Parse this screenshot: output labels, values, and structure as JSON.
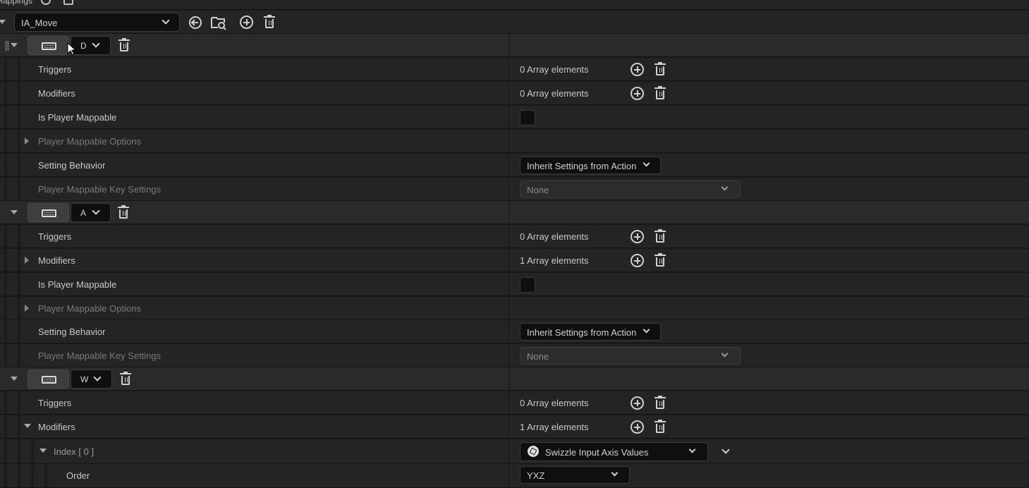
{
  "top": {
    "label": "Mappings"
  },
  "action": {
    "selected": "IA_Move"
  },
  "mappings": [
    {
      "key": "D",
      "rows": [
        {
          "label": "Triggers",
          "value": "0 Array elements"
        },
        {
          "label": "Modifiers",
          "value": "0 Array elements"
        },
        {
          "label": "Is Player Mappable"
        },
        {
          "label": "Player Mappable Options"
        },
        {
          "label": "Setting Behavior",
          "value": "Inherit Settings from Action"
        },
        {
          "label": "Player Mappable Key Settings",
          "value": "None"
        }
      ]
    },
    {
      "key": "A",
      "rows": [
        {
          "label": "Triggers",
          "value": "0 Array elements"
        },
        {
          "label": "Modifiers",
          "value": "1 Array elements"
        },
        {
          "label": "Is Player Mappable"
        },
        {
          "label": "Player Mappable Options"
        },
        {
          "label": "Setting Behavior",
          "value": "Inherit Settings from Action"
        },
        {
          "label": "Player Mappable Key Settings",
          "value": "None"
        }
      ]
    },
    {
      "key": "W",
      "rows": [
        {
          "label": "Triggers",
          "value": "0 Array elements"
        },
        {
          "label": "Modifiers",
          "value": "1 Array elements"
        },
        {
          "label": "Index [ 0 ]",
          "value": "Swizzle Input Axis Values"
        },
        {
          "label": "Order",
          "value": "YXZ"
        }
      ]
    }
  ]
}
